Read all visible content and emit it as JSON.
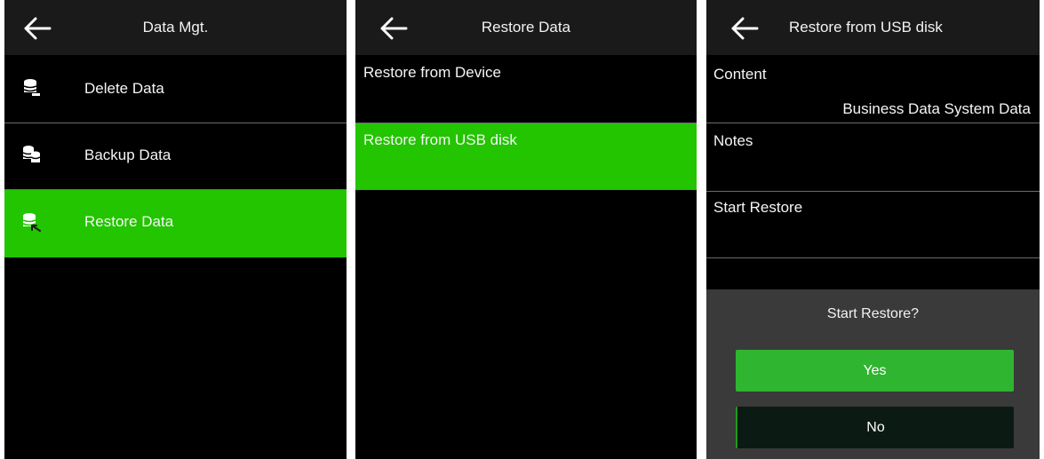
{
  "colors": {
    "accent_green": "#23c400",
    "button_green": "#2fb52f",
    "background": "#000000"
  },
  "panel1": {
    "back_icon": "arrow-left-icon",
    "title": "Data Mgt.",
    "items": [
      {
        "label": "Delete Data",
        "icon": "database-delete-icon"
      },
      {
        "label": "Backup Data",
        "icon": "database-backup-icon"
      },
      {
        "label": "Restore Data",
        "icon": "database-restore-icon",
        "selected": true
      }
    ]
  },
  "panel2": {
    "back_icon": "arrow-left-icon",
    "title": "Restore Data",
    "items": [
      {
        "label": "Restore from Device"
      },
      {
        "label": "Restore from USB disk",
        "selected": true
      }
    ]
  },
  "panel3": {
    "back_icon": "arrow-left-icon",
    "title": "Restore from USB disk",
    "content_label": "Content",
    "content_value": "Business Data System Data",
    "notes_label": "Notes",
    "start_label": "Start Restore",
    "dialog": {
      "question": "Start Restore?",
      "yes": "Yes",
      "no": "No"
    }
  }
}
